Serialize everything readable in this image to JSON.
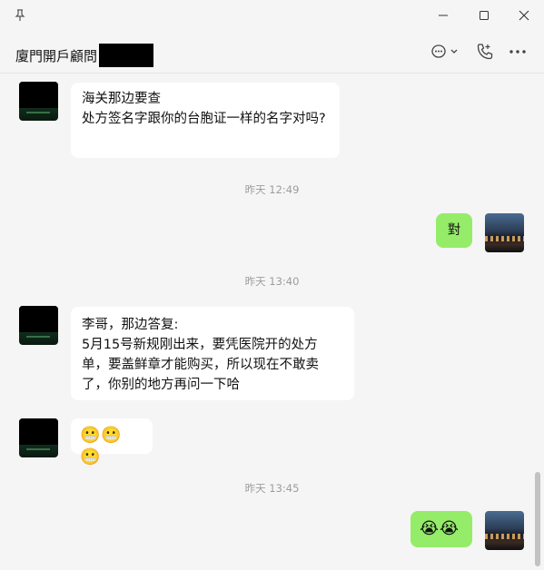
{
  "window": {
    "title": "廈門開戶顧問"
  },
  "messages": [
    {
      "side": "in",
      "text": "海关那边要查\n处方签名字跟你的台胞证一样的名字对吗?"
    },
    {
      "time": "昨天 12:49"
    },
    {
      "side": "out",
      "text": "對"
    },
    {
      "time": "昨天 13:40"
    },
    {
      "side": "in",
      "text": "李哥，那边答复:\n5月15号新规刚出来，要凭医院开的处方单，要盖鲜章才能购买，所以现在不敢卖了，你别的地方再问一下哈"
    },
    {
      "side": "in",
      "text": "😬😬😬"
    },
    {
      "time": "昨天 13:45"
    },
    {
      "side": "out",
      "text": "😭😭"
    }
  ],
  "icons": {
    "pin": "pin-icon",
    "minimize": "minimize-icon",
    "maximize": "maximize-icon",
    "close": "close-icon",
    "chat_options": "chat-bubble-icon",
    "call": "phone-icon",
    "more": "more-icon"
  },
  "colors": {
    "outgoing_bubble": "#95ec69",
    "incoming_bubble": "#ffffff",
    "background": "#f5f5f5",
    "timestamp": "#9c9c9c"
  }
}
